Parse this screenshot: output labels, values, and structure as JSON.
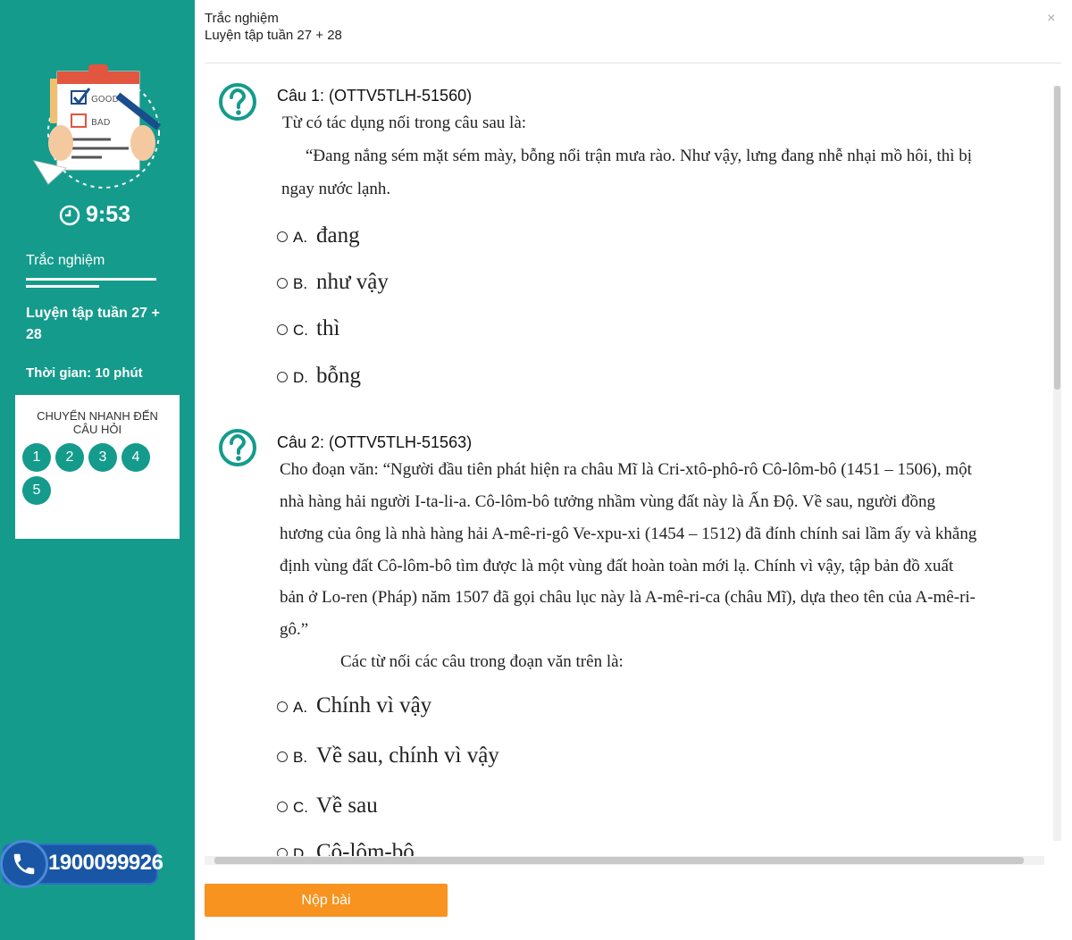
{
  "sidebar": {
    "timer": "9:53",
    "category": "Trắc nghiệm",
    "quiz_title": "Luyện tập tuần 27 + 28",
    "time_limit": "Thời gian: 10 phút",
    "jump_title": "Chuyển nhanh đến câu hỏi",
    "question_numbers": [
      "1",
      "2",
      "3",
      "4",
      "5"
    ],
    "hotline": "1900099926",
    "illustration_labels": [
      "GOOD",
      "BAD"
    ],
    "colors": {
      "sidebar": "#149b8c",
      "hotline": "#1a56a6",
      "submit": "#f7931e"
    }
  },
  "header": {
    "category": "Trắc nghiệm",
    "title": "Luyện tập tuần 27 + 28",
    "close": "×"
  },
  "questions": [
    {
      "heading": "Câu 1: (OTTV5TLH-51560)",
      "prompt": "Từ có tác dụng nối trong câu sau là:",
      "passage_lines": [
        "“Đang nắng sém mặt sém mày, bỗng nổi trận mưa rào. Như vậy, lưng đang nhễ nhại mồ hôi, thì bị",
        "ngay nước lạnh."
      ],
      "options": [
        {
          "letter": "A.",
          "text": "đang"
        },
        {
          "letter": "B.",
          "text": "như vậy"
        },
        {
          "letter": "C.",
          "text": "thì"
        },
        {
          "letter": "D.",
          "text": "bỗng"
        }
      ]
    },
    {
      "heading": "Câu 2: (OTTV5TLH-51563)",
      "passage_lines": [
        "Cho đoạn văn: “Người đầu tiên phát hiện ra châu Mĩ là Cri-xtô-phô-rô Cô-lôm-bô (1451 – 1506), một",
        "nhà hàng hải người I-ta-li-a. Cô-lôm-bô tưởng nhầm vùng đất này là Ấn Độ. Về sau, người đồng",
        "hương của ông là nhà hàng hải A-mê-ri-gô Ve-xpu-xi (1454 – 1512) đã đính chính sai lầm ấy và khẳng",
        "định vùng đất Cô-lôm-bô tìm được là một vùng đất hoàn toàn mới lạ. Chính vì vậy, tập bản đồ xuất",
        "bản ở Lo-ren (Pháp) năm 1507 đã gọi châu lục này là A-mê-ri-ca (châu Mĩ), dựa theo tên của A-mê-ri-",
        "gô.”"
      ],
      "prompt": "Các từ nối các câu trong đoạn văn trên là:",
      "options": [
        {
          "letter": "A.",
          "text": "Chính vì vậy"
        },
        {
          "letter": "B.",
          "text": "Về sau, chính vì vậy"
        },
        {
          "letter": "C.",
          "text": "Về sau"
        },
        {
          "letter": "D.",
          "text": "Cô-lôm-bô"
        }
      ]
    }
  ],
  "submit_label": "Nộp bài"
}
